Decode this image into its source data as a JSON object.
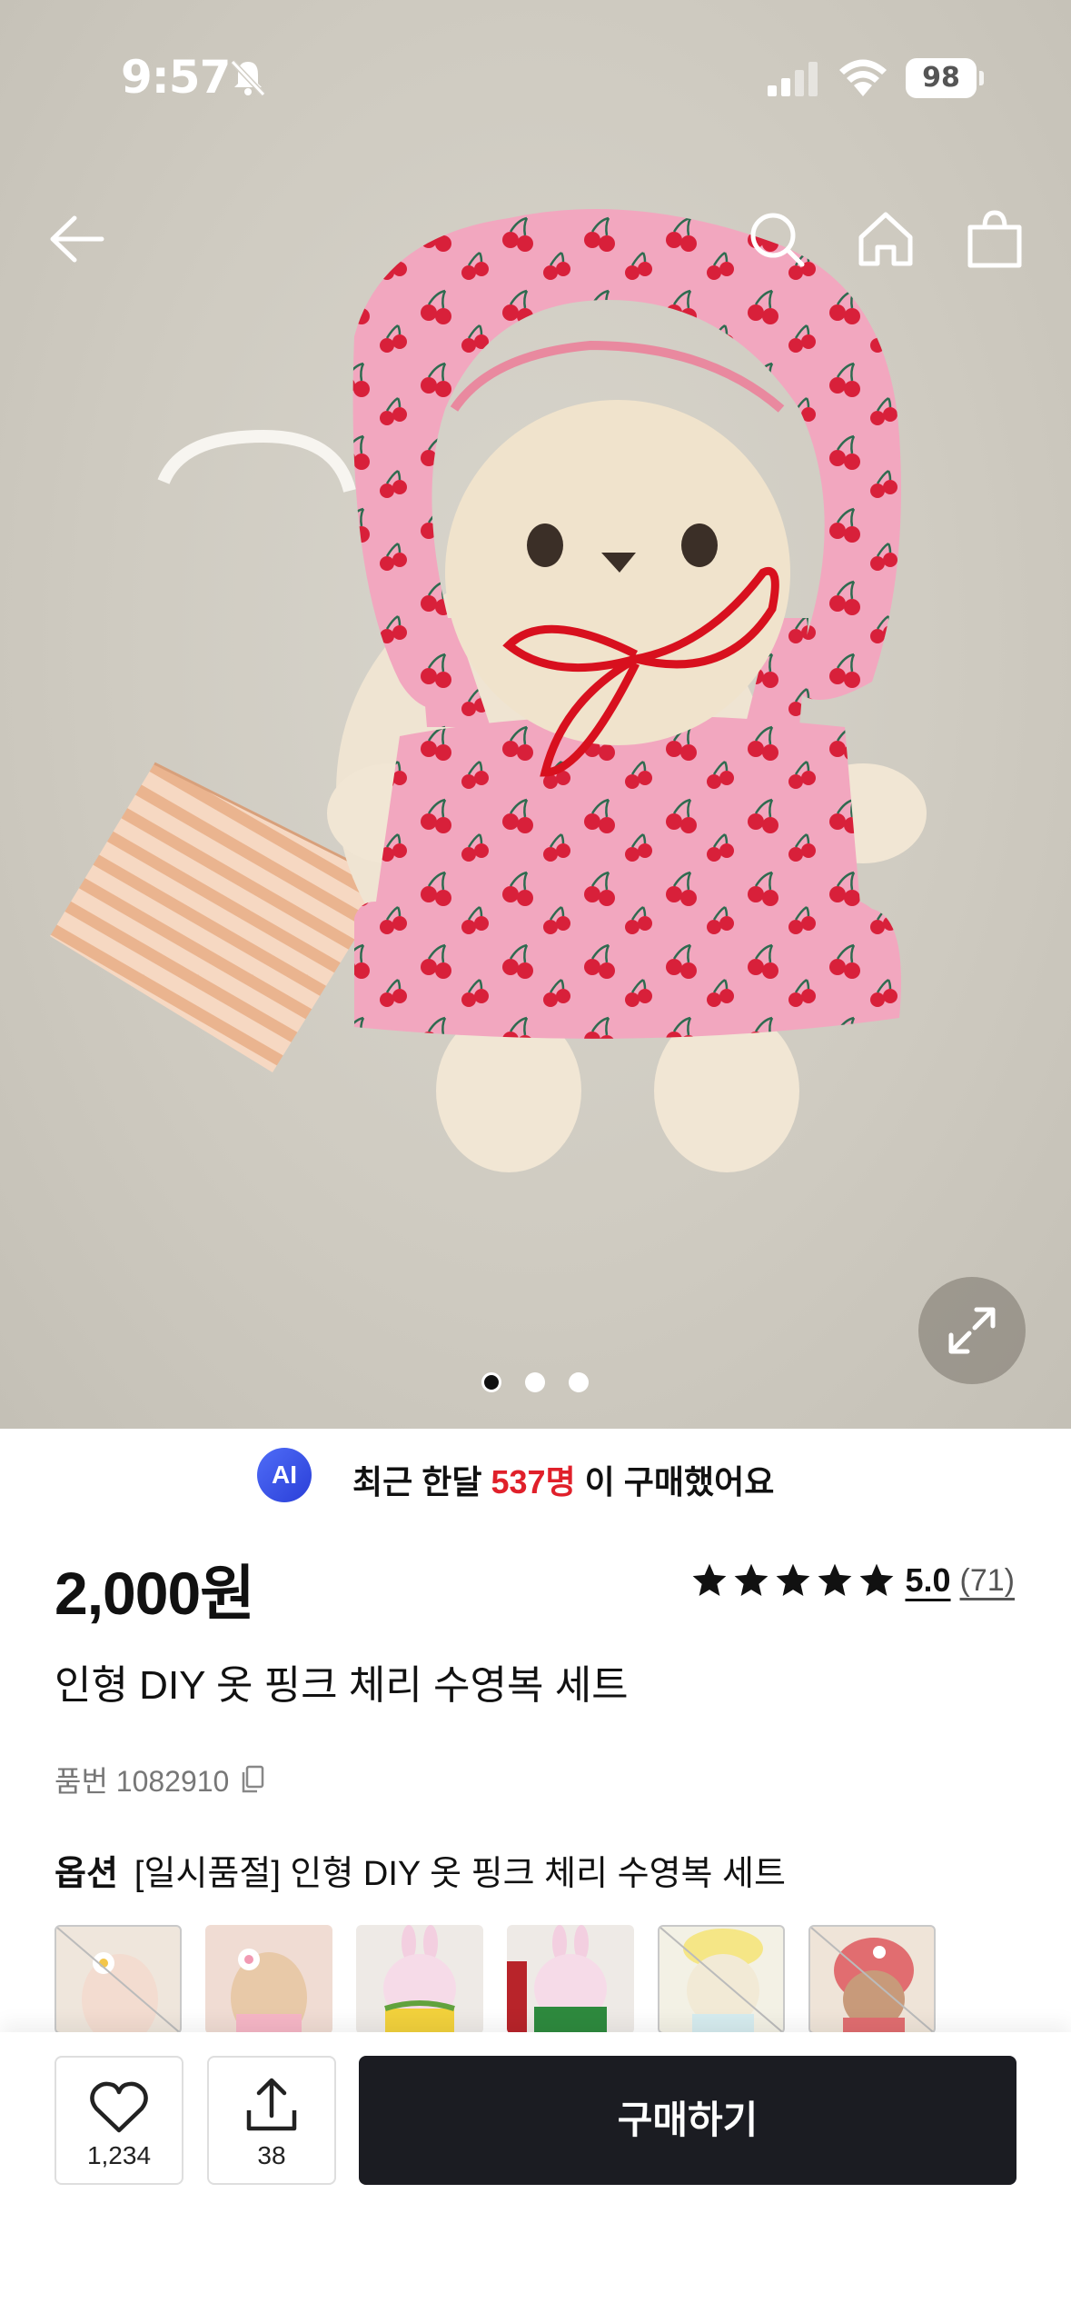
{
  "status_bar": {
    "time": "9:57",
    "battery": "98"
  },
  "header": {
    "icons": [
      "back-arrow-icon",
      "search-icon",
      "home-icon",
      "shopping-bag-icon"
    ]
  },
  "gallery": {
    "page_count": 3,
    "current_page": 1
  },
  "ai_banner": {
    "badge": "AI",
    "prefix": "최근 한달 ",
    "highlight": "537명",
    "suffix": " 이 구매했어요",
    "highlight_color": "#e0202a"
  },
  "product": {
    "price": "2,000원",
    "rating_score": "5.0",
    "rating_count": "(71)",
    "stars": 5,
    "title": "인형 DIY 옷 핑크 체리 수영복 세트",
    "sku": "품번 1082910"
  },
  "option": {
    "label": "옵션",
    "selected": "[일시품절] 인형 DIY 옷 핑크 체리 수영복 세트",
    "thumbnails": [
      {
        "name": "option-thumb-1",
        "sold_out": true
      },
      {
        "name": "option-thumb-2",
        "sold_out": false
      },
      {
        "name": "option-thumb-3",
        "sold_out": false
      },
      {
        "name": "option-thumb-4",
        "sold_out": false
      },
      {
        "name": "option-thumb-5",
        "sold_out": true
      },
      {
        "name": "option-thumb-6",
        "sold_out": true
      }
    ]
  },
  "bottom_bar": {
    "like_count": "1,234",
    "share_count": "38",
    "buy_label": "구매하기"
  },
  "colors": {
    "buy_button": "#1b1c22",
    "accent_red": "#e0202a",
    "ai_badge": "#3a52e8"
  }
}
